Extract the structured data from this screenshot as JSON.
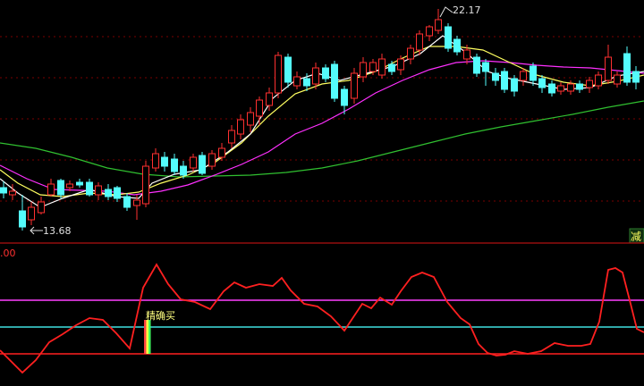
{
  "price_panel": {
    "high_label": "22.17",
    "low_label": "13.68",
    "right_badge": "减"
  },
  "indicator_panel": {
    "axis_label": ".00",
    "signal_label": "精确买"
  },
  "colors": {
    "background": "#000000",
    "up_candle": "#ff3030",
    "down_candle": "#54fcfc",
    "ma_short": "#ffffff",
    "ma_mid": "#ffff60",
    "ma_long": "#ff30ff",
    "ma_longest": "#30c030",
    "indicator_line": "#ff2020",
    "level_high": "#ff40ff",
    "level_mid": "#40e0e0",
    "level_low": "#ff2020",
    "divider": "#b01010",
    "grid": "#7a0000",
    "label": "#e0e0e0",
    "signal_label": "#ffff80",
    "badge_bg": "#103010",
    "badge_text": "#ffff60"
  }
}
